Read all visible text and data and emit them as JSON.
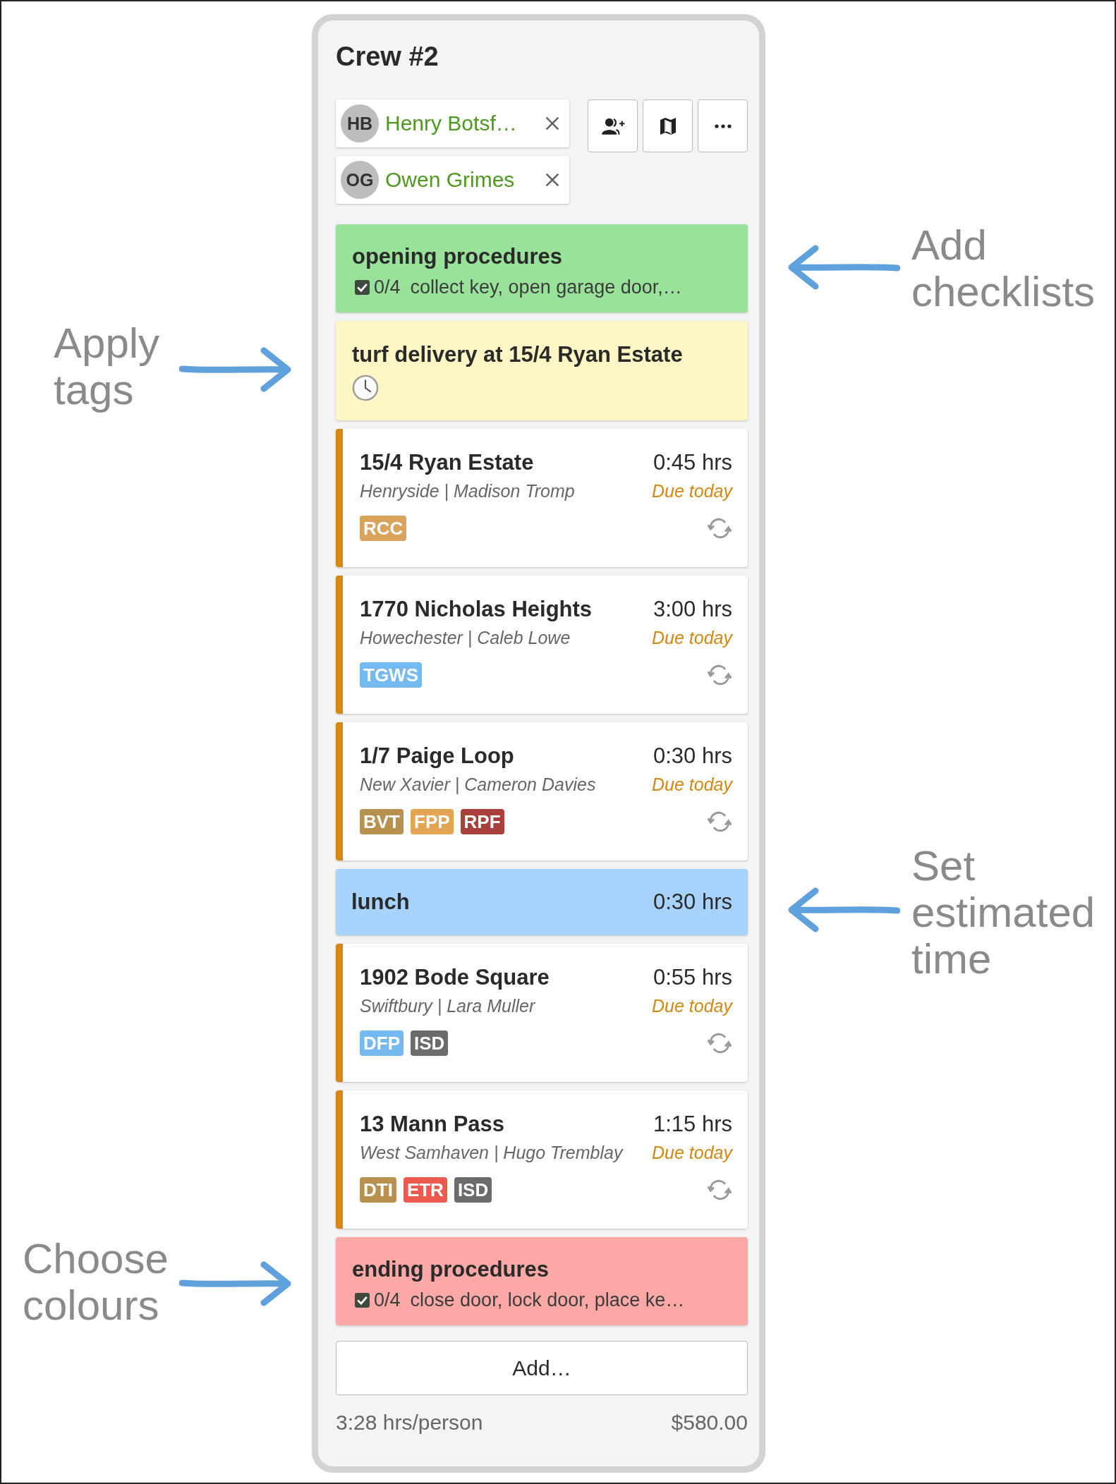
{
  "title": "Crew #2",
  "members": [
    {
      "initials": "HB",
      "name": "Henry Botsf…"
    },
    {
      "initials": "OG",
      "name": "Owen Grimes"
    }
  ],
  "toolbar": [
    {
      "kind": "add-person"
    },
    {
      "kind": "map"
    },
    {
      "kind": "more"
    }
  ],
  "items": [
    {
      "kind": "checklist",
      "color": "#98e29a",
      "title": "opening procedures",
      "progress": "0/4",
      "summary": "collect key, open garage door,…"
    },
    {
      "kind": "note",
      "color": "#fdf5c4",
      "title": "turf delivery at 15/4 Ryan Estate"
    },
    {
      "kind": "job",
      "title": "15/4 Ryan Estate",
      "duration": "0:45 hrs",
      "subtitle": "Henryside | Madison Tromp",
      "due": "Due today",
      "tags": [
        {
          "label": "RCC",
          "color": "#d9a35c"
        }
      ]
    },
    {
      "kind": "job",
      "title": "1770 Nicholas Heights",
      "duration": "3:00 hrs",
      "subtitle": "Howechester | Caleb Lowe",
      "due": "Due today",
      "tags": [
        {
          "label": "TGWS",
          "color": "#74b9f0"
        }
      ]
    },
    {
      "kind": "job",
      "title": "1/7 Paige Loop",
      "duration": "0:30 hrs",
      "subtitle": "New Xavier | Cameron Davies",
      "due": "Due today",
      "tags": [
        {
          "label": "BVT",
          "color": "#b8914f"
        },
        {
          "label": "FPP",
          "color": "#e3a552"
        },
        {
          "label": "RPF",
          "color": "#a9403b"
        }
      ]
    },
    {
      "kind": "break",
      "color": "#a7d2fc",
      "title": "lunch",
      "duration": "0:30 hrs"
    },
    {
      "kind": "job",
      "title": "1902 Bode Square",
      "duration": "0:55 hrs",
      "subtitle": "Swiftbury | Lara Muller",
      "due": "Due today",
      "tags": [
        {
          "label": "DFP",
          "color": "#74b9f0"
        },
        {
          "label": "ISD",
          "color": "#6b6b6b"
        }
      ]
    },
    {
      "kind": "job",
      "title": "13 Mann Pass",
      "duration": "1:15 hrs",
      "subtitle": "West Samhaven | Hugo Tremblay",
      "due": "Due today",
      "tags": [
        {
          "label": "DTI",
          "color": "#b8914f"
        },
        {
          "label": "ETR",
          "color": "#ec5a4f"
        },
        {
          "label": "ISD",
          "color": "#6b6b6b"
        }
      ]
    },
    {
      "kind": "checklist",
      "color": "#fba8a6",
      "title": "ending procedures",
      "progress": "0/4",
      "summary": "close door, lock door, place ke…"
    }
  ],
  "add_button": "Add…",
  "footer": {
    "hours": "3:28 hrs/person",
    "total": "$580.00"
  },
  "annotations": [
    {
      "lines": [
        "Add",
        "checklists"
      ],
      "kind": "right"
    },
    {
      "lines": [
        "Apply",
        "tags"
      ],
      "kind": "left"
    },
    {
      "lines": [
        "Set",
        "estimated",
        "time"
      ],
      "kind": "right"
    },
    {
      "lines": [
        "Choose",
        "colours"
      ],
      "kind": "left"
    }
  ]
}
